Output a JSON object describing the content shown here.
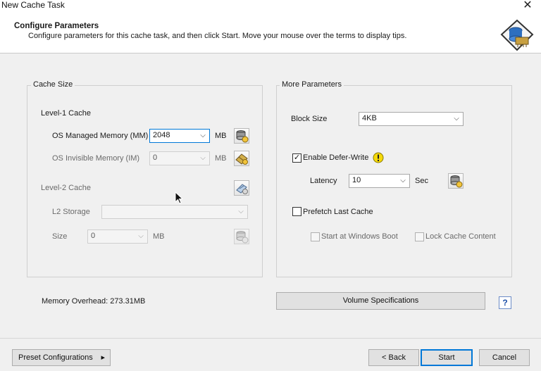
{
  "window": {
    "title": "New Cache Task",
    "close_glyph": "✕"
  },
  "header": {
    "title": "Configure Parameters",
    "subtitle": "Configure parameters for this cache task, and then click Start. Move your mouse over the terms to display tips.",
    "icon": "disk-cache-icon"
  },
  "cache_size": {
    "group_title": "Cache Size",
    "level1": {
      "title": "Level-1 Cache",
      "os_managed": {
        "label": "OS Managed Memory (MM)",
        "value": "2048",
        "unit": "MB",
        "icon": "memory-settings-icon"
      },
      "os_invisible": {
        "label": "OS Invisible Memory (IM)",
        "value": "0",
        "unit": "MB",
        "icon": "memory-chip-icon"
      }
    },
    "level2": {
      "title": "Level-2 Cache",
      "icon": "ssd-settings-icon",
      "storage": {
        "label": "L2 Storage",
        "value": ""
      },
      "size": {
        "label": "Size",
        "value": "0",
        "unit": "MB",
        "icon": "storage-settings-icon"
      }
    }
  },
  "more_params": {
    "group_title": "More Parameters",
    "block_size": {
      "label": "Block Size",
      "value": "4KB"
    },
    "defer_write": {
      "label": "Enable Defer-Write",
      "checked": true,
      "warning_icon": "warning-icon"
    },
    "latency": {
      "label": "Latency",
      "value": "10",
      "unit": "Sec",
      "icon": "latency-settings-icon"
    },
    "prefetch": {
      "label": "Prefetch Last Cache",
      "checked": false
    },
    "start_boot": {
      "label": "Start at Windows Boot",
      "checked": false
    },
    "lock_cache": {
      "label": "Lock Cache Content",
      "checked": false
    }
  },
  "memory_overhead": "Memory Overhead: 273.31MB",
  "volume_button": "Volume Specifications",
  "help_glyph": "?",
  "footer": {
    "preset_label": "Preset Configurations",
    "preset_arrow": "▸",
    "back_label": "< Back",
    "start_label": "Start",
    "cancel_label": "Cancel"
  }
}
